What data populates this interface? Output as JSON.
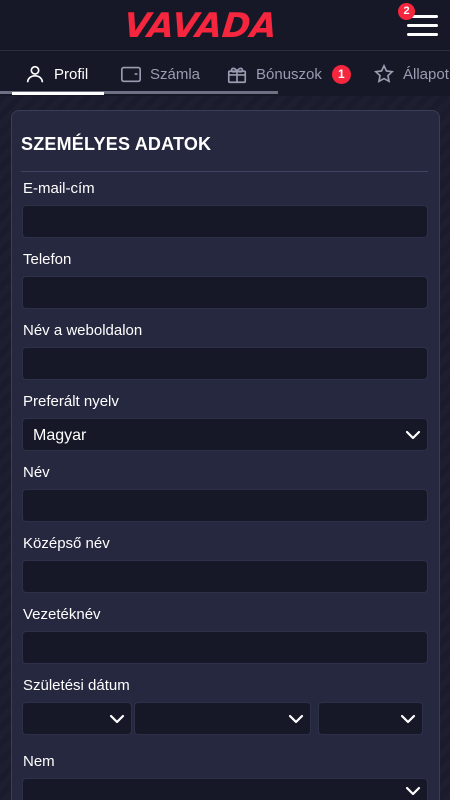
{
  "header": {
    "logo_text": "VAVADA",
    "menu_badge": "2"
  },
  "tabs": [
    {
      "label": "Profil",
      "icon": "user-icon",
      "active": true
    },
    {
      "label": "Számla",
      "icon": "wallet-icon",
      "active": false
    },
    {
      "label": "Bónuszok",
      "icon": "gift-icon",
      "active": false,
      "badge": "1"
    },
    {
      "label": "Állapot",
      "icon": "star-icon",
      "active": false
    }
  ],
  "form": {
    "title": "SZEMÉLYES ADATOK",
    "email_label": "E-mail-cím",
    "email_value": "",
    "phone_label": "Telefon",
    "phone_value": "",
    "site_name_label": "Név a weboldalon",
    "site_name_value": "",
    "language_label": "Preferált nyelv",
    "language_value": "Magyar",
    "first_name_label": "Név",
    "first_name_value": "",
    "middle_name_label": "Középső név",
    "middle_name_value": "",
    "last_name_label": "Vezetéknév",
    "last_name_value": "",
    "birth_date_label": "Születési dátum",
    "birth_day_value": "",
    "birth_month_value": "",
    "birth_year_value": "",
    "gender_label": "Nem",
    "gender_value": ""
  },
  "colors": {
    "accent": "#f5263d",
    "background": "#171827",
    "card": "#26283f",
    "input": "#171827"
  }
}
